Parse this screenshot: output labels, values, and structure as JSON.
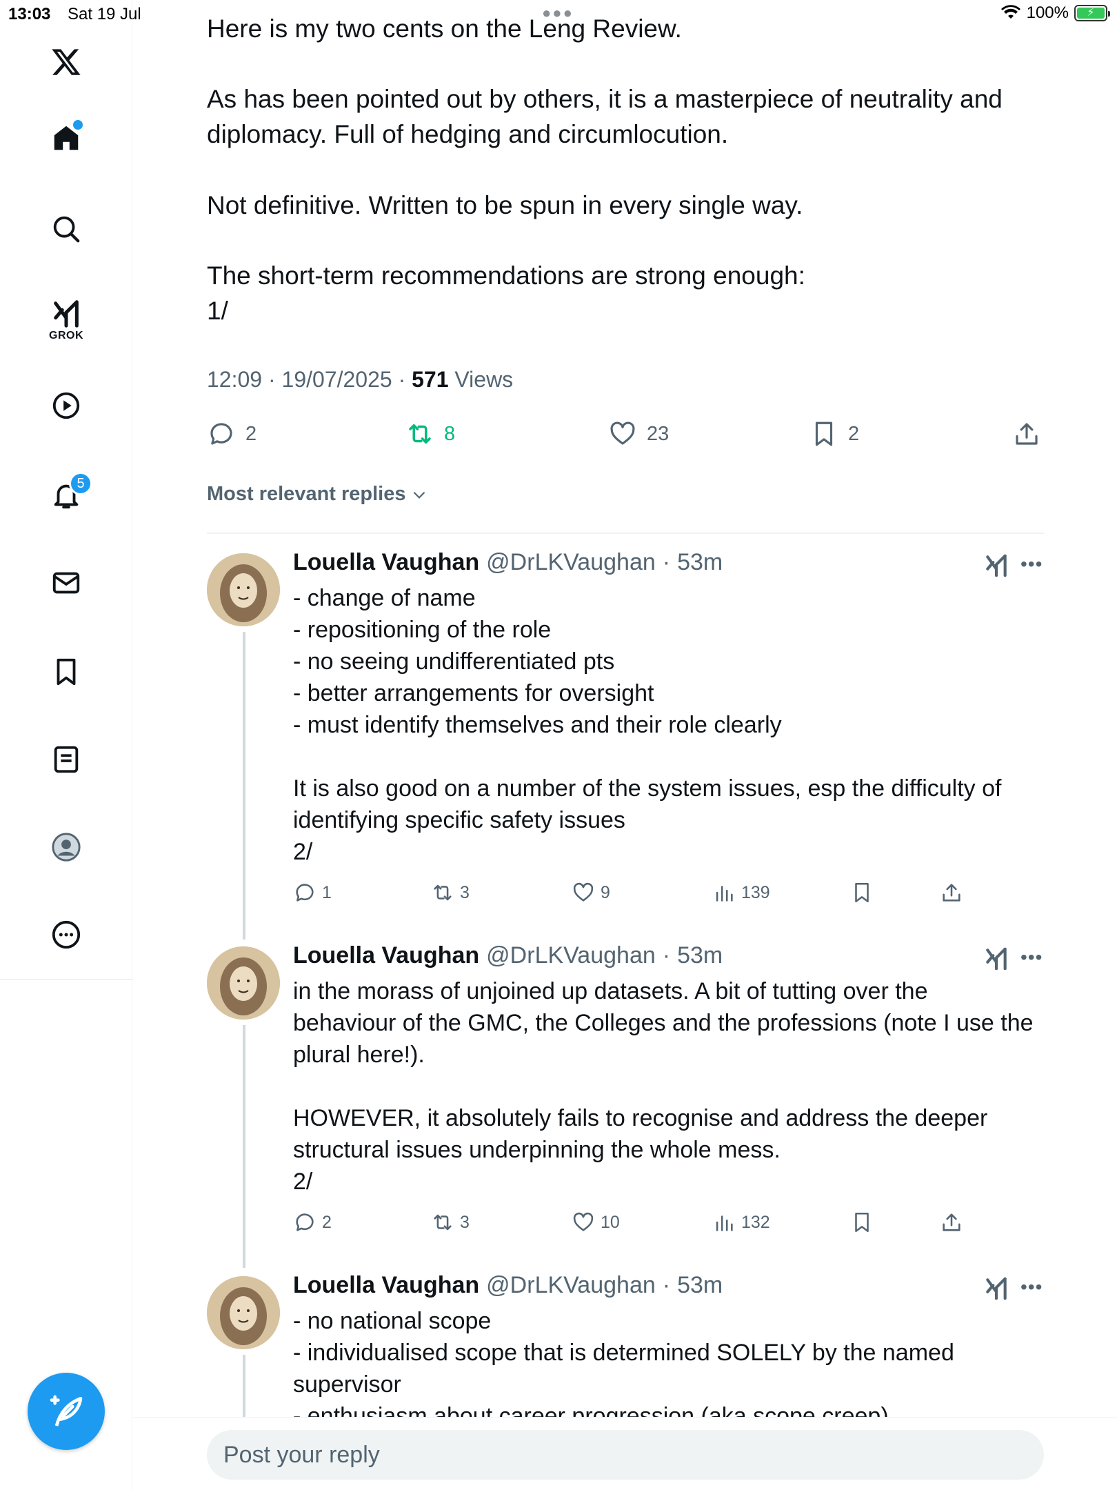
{
  "status_bar": {
    "time": "13:03",
    "date": "Sat 19 Jul",
    "battery": "100%"
  },
  "sidebar": {
    "items": [
      {
        "name": "x-logo-icon"
      },
      {
        "name": "home-icon"
      },
      {
        "name": "search-icon"
      },
      {
        "name": "grok-icon",
        "label": "GROK"
      },
      {
        "name": "video-icon"
      },
      {
        "name": "notifications-icon",
        "badge": "5"
      },
      {
        "name": "messages-icon"
      },
      {
        "name": "bookmarks-icon"
      },
      {
        "name": "lists-icon"
      },
      {
        "name": "profile-icon"
      },
      {
        "name": "more-icon"
      }
    ],
    "compose_icon": "compose-icon"
  },
  "tweet": {
    "text_cut": "Here is my two cents on the Leng Review.",
    "paragraph_1": "As has been pointed out by others, it is a masterpiece of neutrality and\ndiplomacy. Full of hedging and circumlocution.",
    "paragraph_2": "Not definitive. Written to be spun in every single way.",
    "paragraph_3": "The short-term recommendations are strong enough:\n1/",
    "time": "12:09",
    "date": "19/07/2025",
    "views_count": "571",
    "views_label": "Views",
    "replies": "2",
    "reposts": "8",
    "likes": "23",
    "bookmarks": "2"
  },
  "replies_filter": "Most relevant replies",
  "replies": [
    {
      "name": "Louella Vaughan",
      "handle": "@DrLKVaughan",
      "age": "53m",
      "body": "- change of name\n- repositioning of the role\n- no seeing undifferentiated pts\n- better arrangements for oversight\n- must identify themselves and their role clearly\n\nIt is also good on a number of the system issues, esp the difficulty of\nidentifying specific safety issues\n2/",
      "replies": "1",
      "reposts": "3",
      "likes": "9",
      "views": "139"
    },
    {
      "name": "Louella Vaughan",
      "handle": "@DrLKVaughan",
      "age": "53m",
      "body": "in the morass of unjoined up datasets. A bit of tutting over the\nbehaviour of the GMC, the Colleges and the professions (note I use the\nplural here!).\n\nHOWEVER, it absolutely fails to recognise and address the deeper\nstructural issues underpinning the whole mess.\n2/",
      "replies": "2",
      "reposts": "3",
      "likes": "10",
      "views": "132"
    },
    {
      "name": "Louella Vaughan",
      "handle": "@DrLKVaughan",
      "age": "53m",
      "body": "- no national scope\n- individualised scope that is determined SOLELY by the named\nsupervisor\n- enthusiasm about career progression (aka scope creep)"
    }
  ],
  "reply_box": {
    "placeholder": "Post your reply"
  },
  "colors": {
    "accent": "#1d9bf0",
    "repost_green": "#00ba7c",
    "muted": "#536471",
    "text": "#0f1419"
  }
}
